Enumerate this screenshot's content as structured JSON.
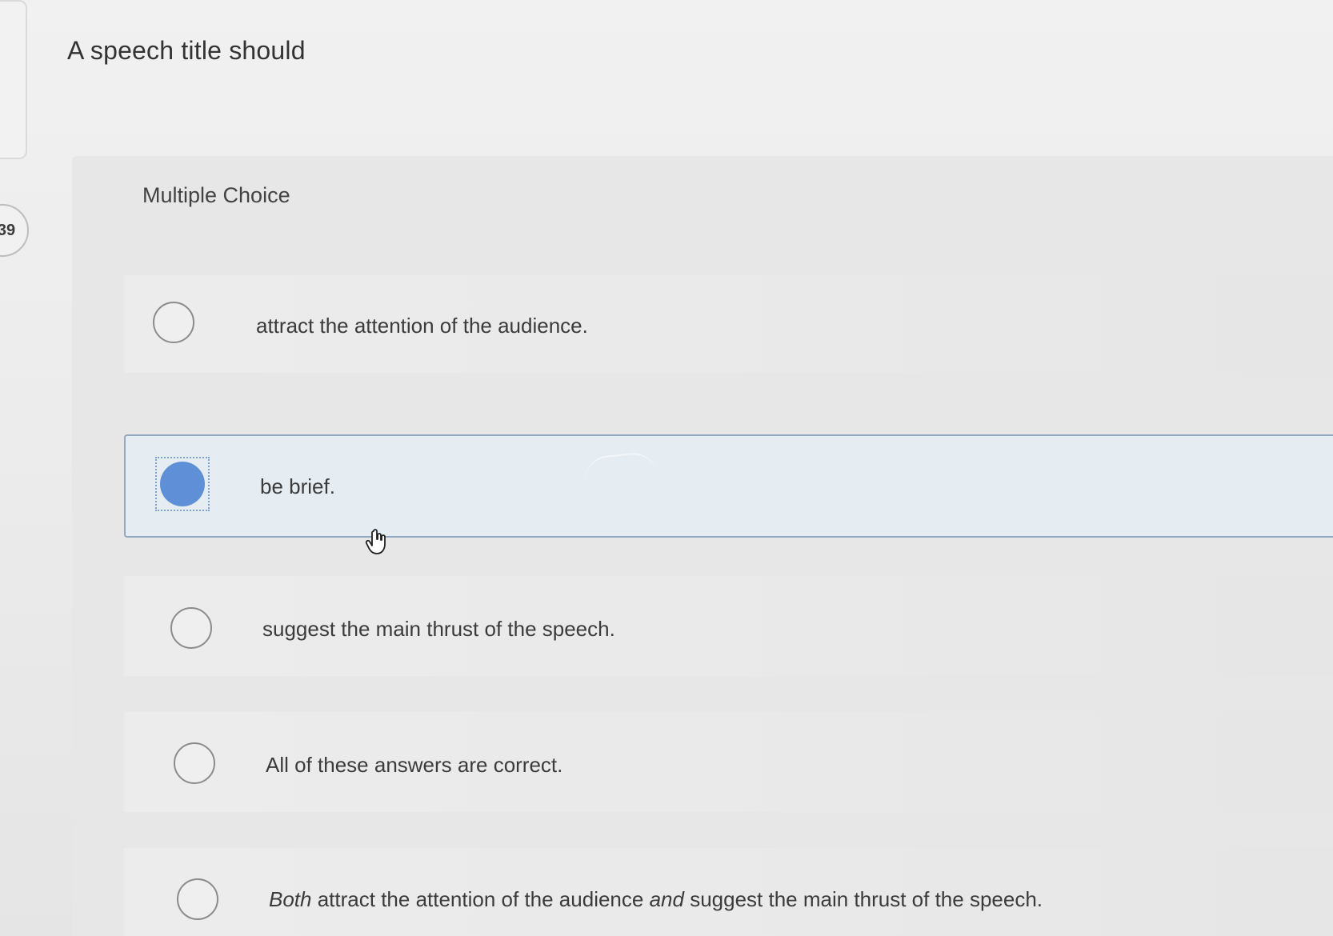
{
  "question": {
    "number": "39",
    "prompt": "A speech title should",
    "type_label": "Multiple Choice"
  },
  "options": [
    {
      "id": "a",
      "text": "attract the attention of the audience.",
      "selected": false
    },
    {
      "id": "b",
      "text": "be brief.",
      "selected": true
    },
    {
      "id": "c",
      "text": "suggest the main thrust of the speech.",
      "selected": false
    },
    {
      "id": "d",
      "text": "All of these answers are correct.",
      "selected": false
    },
    {
      "id": "e",
      "text_parts": {
        "lead": "Both",
        "middle": " attract the attention of the audience ",
        "join": "and",
        "tail": " suggest the main thrust of the speech."
      },
      "selected": false
    }
  ],
  "colors": {
    "selected_fill": "#5f8fd6",
    "selected_option_bg": "#e6edf2",
    "selected_border": "#93a9c0"
  },
  "icons": {
    "cursor": "hand-pointer-icon",
    "radio_unchecked": "radio-circle-icon",
    "radio_checked": "radio-filled-icon"
  }
}
